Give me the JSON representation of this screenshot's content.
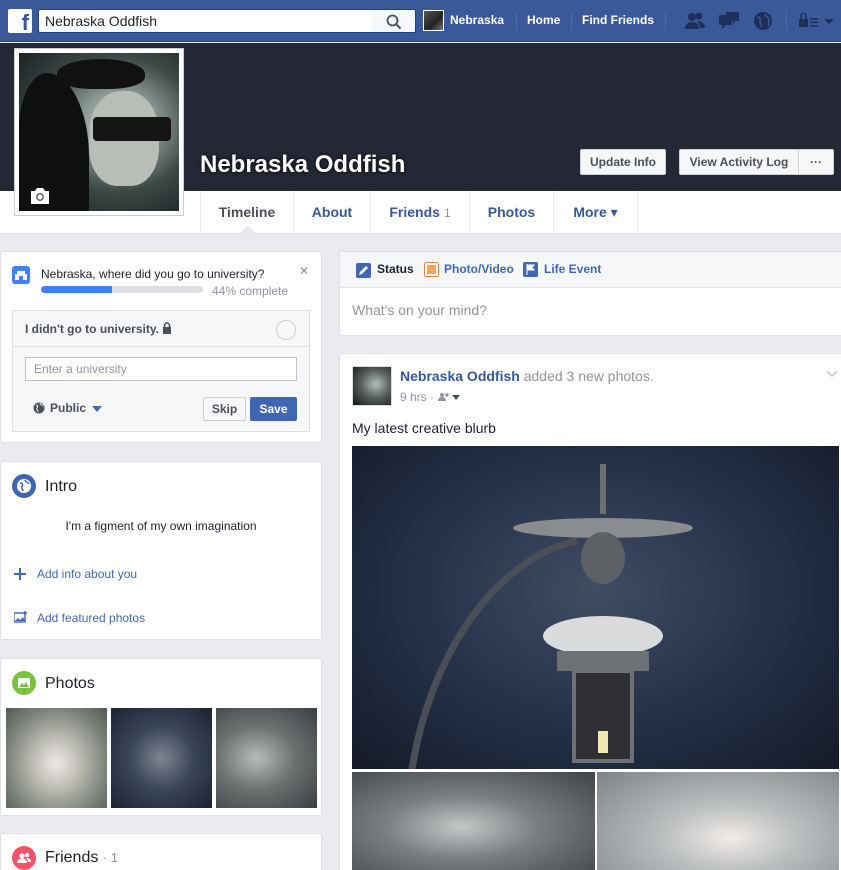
{
  "topbar": {
    "logo": "f",
    "search_value": "Nebraska Oddfish",
    "user_name": "Nebraska",
    "home": "Home",
    "find_friends": "Find Friends"
  },
  "profile": {
    "name": "Nebraska Oddfish",
    "update_info": "Update Info",
    "view_activity_log": "View Activity Log",
    "more_dots": "···"
  },
  "tabs": [
    {
      "label": "Timeline"
    },
    {
      "label": "About"
    },
    {
      "label": "Friends",
      "count": "1"
    },
    {
      "label": "Photos"
    },
    {
      "label": "More ▾"
    }
  ],
  "university": {
    "question": "Nebraska, where did you go to university?",
    "progress_percent": 44,
    "progress_text": "44% complete",
    "didnt_go": "I didn't go to university.",
    "input_placeholder": "Enter a university",
    "privacy": "Public",
    "skip": "Skip",
    "save": "Save",
    "close": "✕"
  },
  "intro": {
    "title": "Intro",
    "bio": "I'm a figment of my own imagination",
    "add_info": "Add info about you",
    "add_photos": "Add featured photos"
  },
  "photos_card": {
    "title": "Photos"
  },
  "friends_card": {
    "title": "Friends",
    "count": "· 1"
  },
  "composer": {
    "status": "Status",
    "photo_video": "Photo/Video",
    "life_event": "Life Event",
    "placeholder": "What's on your mind?"
  },
  "post": {
    "author": "Nebraska Oddfish",
    "action": "added 3 new photos.",
    "time": "9 hrs",
    "separator": "·",
    "text": "My latest creative blurb"
  },
  "colors": {
    "brand": "#3b5998",
    "link": "#4267b2",
    "cover": "#242734",
    "progress": "#4080ff"
  }
}
